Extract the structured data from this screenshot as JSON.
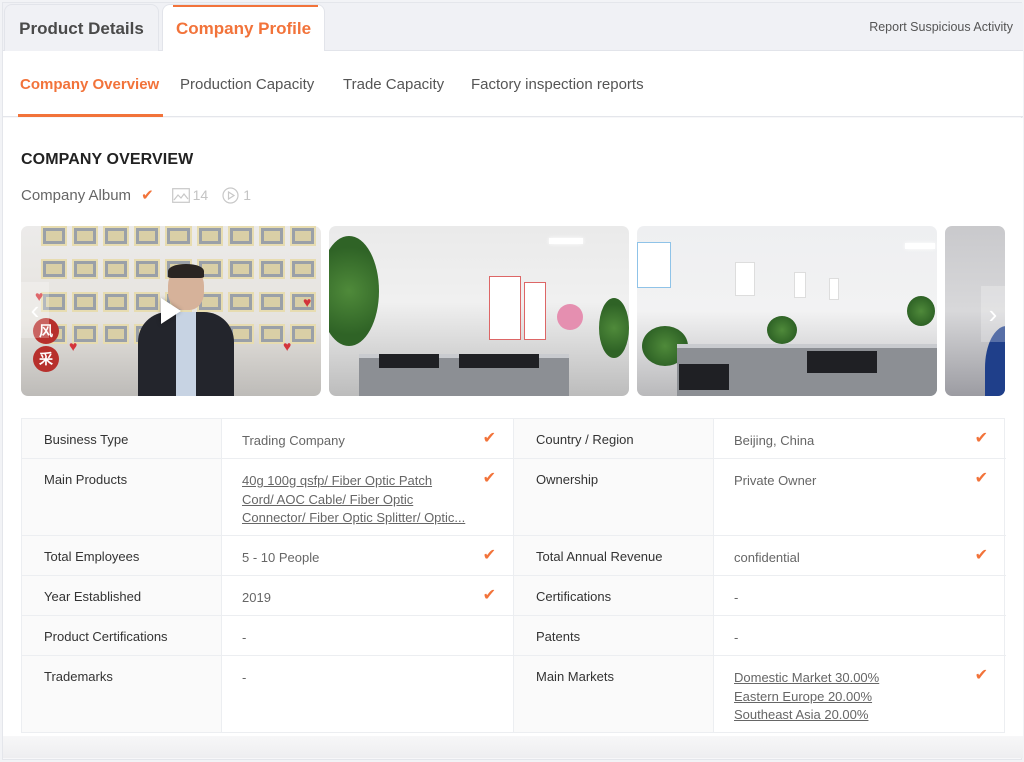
{
  "top_tabs": [
    {
      "label": "Product Details",
      "active": false
    },
    {
      "label": "Company Profile",
      "active": true
    }
  ],
  "report_link": "Report Suspicious Activity",
  "sub_tabs": [
    {
      "label": "Company Overview",
      "active": true
    },
    {
      "label": "Production Capacity",
      "active": false
    },
    {
      "label": "Trade Capacity",
      "active": false
    },
    {
      "label": "Factory inspection reports",
      "active": false
    }
  ],
  "section_title": "COMPANY OVERVIEW",
  "album": {
    "label": "Company Album",
    "verified_icon": "check-icon",
    "photo_icon": "image-icon",
    "photo_count": "14",
    "video_icon": "play-circle-icon",
    "video_count": "1"
  },
  "gallery": {
    "photos": [
      {
        "description": "Video thumbnail: man in suit in front of photo wall",
        "is_video": true
      },
      {
        "description": "Office with plants and workstations",
        "is_video": false
      },
      {
        "description": "Open-plan office with cubicles and staff",
        "is_video": false
      },
      {
        "description": "Office wall with calligraphy mural",
        "is_video": false
      }
    ],
    "prev_icon": "chevron-left-icon",
    "next_icon": "chevron-right-icon"
  },
  "info": {
    "left": [
      {
        "label": "Business Type",
        "value": "Trading Company",
        "verified": true
      },
      {
        "label": "Main Products",
        "links": [
          "40g 100g qsfp/ Fiber Optic Patch",
          "Cord/ AOC Cable/ Fiber Optic",
          "Connector/ Fiber Optic Splitter/ Optic..."
        ],
        "verified": true
      },
      {
        "label": "Total Employees",
        "value": "5 - 10 People",
        "verified": true
      },
      {
        "label": "Year Established",
        "value": "2019",
        "verified": true
      },
      {
        "label": "Product Certifications",
        "value": "-",
        "verified": false
      },
      {
        "label": "Trademarks",
        "value": "-",
        "verified": false
      }
    ],
    "right": [
      {
        "label": "Country / Region",
        "value": "Beijing, China",
        "verified": true
      },
      {
        "label": "Ownership",
        "value": "Private Owner",
        "verified": true
      },
      {
        "label": "Total Annual Revenue",
        "value": "confidential",
        "verified": true
      },
      {
        "label": "Certifications",
        "value": "-",
        "verified": false
      },
      {
        "label": "Patents",
        "value": "-",
        "verified": false
      },
      {
        "label": "Main Markets",
        "links": [
          "Domestic Market 30.00%",
          "Eastern Europe 20.00%",
          "Southeast Asia 20.00%"
        ],
        "verified": true
      }
    ],
    "check_glyph": "✔"
  },
  "colors": {
    "accent": "#f2733a",
    "label_bg": "#fafafa",
    "border": "#eceef1"
  }
}
